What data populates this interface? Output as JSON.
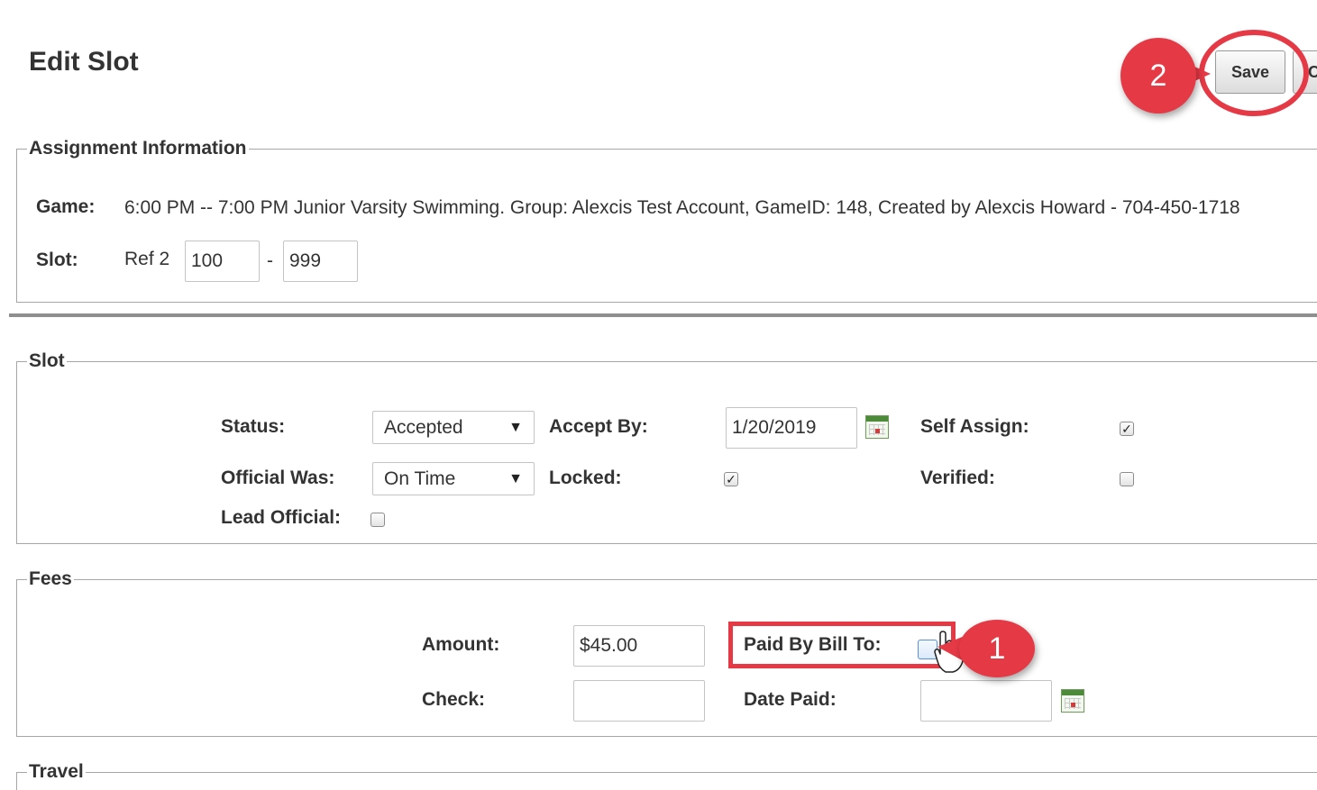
{
  "header": {
    "title": "Edit Slot",
    "save_label": "Save",
    "cancel_label_partial": "C"
  },
  "assignment": {
    "legend": "Assignment Information",
    "game_label": "Game:",
    "game_value": "6:00 PM -- 7:00 PM Junior Varsity Swimming. Group: Alexcis Test Account, GameID: 148, Created by Alexcis Howard - 704-450-1718",
    "slot_label": "Slot:",
    "slot_ref": "Ref 2",
    "slot_from": "100",
    "slot_sep": "-",
    "slot_to": "999"
  },
  "slot": {
    "legend": "Slot",
    "status_label": "Status:",
    "status_value": "Accepted",
    "accept_by_label": "Accept By:",
    "accept_by_value": "1/20/2019",
    "self_assign_label": "Self Assign:",
    "self_assign_checked": true,
    "official_was_label": "Official Was:",
    "official_was_value": "On Time",
    "locked_label": "Locked:",
    "locked_checked": true,
    "verified_label": "Verified:",
    "verified_checked": false,
    "lead_official_label": "Lead Official:",
    "lead_official_checked": false
  },
  "fees": {
    "legend": "Fees",
    "amount_label": "Amount:",
    "amount_value": "$45.00",
    "paid_by_bill_to_label": "Paid By Bill To:",
    "paid_by_bill_to_checked": false,
    "check_label": "Check:",
    "check_value": "",
    "date_paid_label": "Date Paid:",
    "date_paid_value": ""
  },
  "travel": {
    "legend": "Travel"
  },
  "annotations": {
    "step1": "1",
    "step2": "2",
    "highlight_color": "#e63946"
  },
  "icons": {
    "dropdown": "chevron-down-icon",
    "calendar": "calendar-icon",
    "check": "checkmark-icon",
    "cursor": "hand-pointer-icon"
  }
}
